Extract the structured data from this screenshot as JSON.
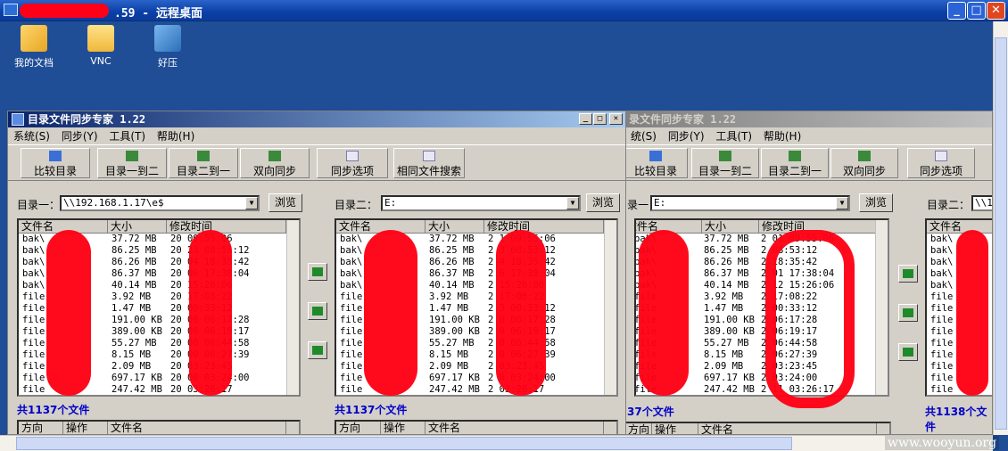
{
  "remote_title": ".59 - 远程桌面",
  "desktop_icons": [
    {
      "label": "我的文档"
    },
    {
      "label": "VNC"
    },
    {
      "label": "好压"
    }
  ],
  "app": {
    "title": "目录文件同步专家 1.22",
    "menu": [
      "系统(S)",
      "同步(Y)",
      "工具(T)",
      "帮助(H)"
    ],
    "toolbar": [
      "比较目录",
      "目录一到二",
      "目录二到一",
      "双向同步",
      "同步选项",
      "相同文件搜索"
    ],
    "browse_label": "浏览",
    "cols": [
      "文件名",
      "大小",
      "修改时间"
    ],
    "bottom_cols": [
      "方向",
      "操作",
      "文件名"
    ]
  },
  "window1": {
    "dir1_label": "目录一：",
    "dir1_value": "\\\\192.168.1.17\\e$",
    "dir2_label": "目录二：",
    "dir2_value": "E:",
    "count1": "共1137个文件",
    "count2": "共1137个文件",
    "left_rows": [
      {
        "name": "bak\\",
        "size": "37.72 MB",
        "time": "20   09:55:06"
      },
      {
        "name": "bak\\",
        "size": "86.25 MB",
        "time": "20  23 08:53:12"
      },
      {
        "name": "bak\\",
        "size": "86.26 MB",
        "time": "20  04 18:35:42"
      },
      {
        "name": "bak\\",
        "size": "86.37 MB",
        "time": "20  06 17:38:04"
      },
      {
        "name": "bak\\",
        "size": "40.14 MB",
        "time": "20    15:26:06"
      },
      {
        "name": "file",
        "size": "3.92 MB",
        "time": "20    17:08:22"
      },
      {
        "name": "file",
        "size": "1.47 MB",
        "time": "20    00:33:12"
      },
      {
        "name": "file",
        "size": "191.00 KB",
        "time": "20  00 06:17:28"
      },
      {
        "name": "file",
        "size": "389.00 KB",
        "time": "20  00 06:19:17"
      },
      {
        "name": "file",
        "size": "55.27 MB",
        "time": "20  00 06:44:58"
      },
      {
        "name": "file",
        "size": "8.15 MB",
        "time": "20  00 06:27:39"
      },
      {
        "name": "file",
        "size": "2.09 MB",
        "time": "20    03:23:45"
      },
      {
        "name": "file",
        "size": "697.17 KB",
        "time": "20  00 03:24:00"
      },
      {
        "name": "file",
        "size": "247.42 MB",
        "time": "20    03:26:17"
      }
    ],
    "right_rows": [
      {
        "name": "bak\\",
        "size": "37.72 MB",
        "time": "2   1 09:55:06"
      },
      {
        "name": "bak\\",
        "size": "86.25 MB",
        "time": "2   3 08:53:12"
      },
      {
        "name": "bak\\",
        "size": "86.26 MB",
        "time": "2   4 18:35:42"
      },
      {
        "name": "bak\\",
        "size": "86.37 MB",
        "time": "2   6 17:38:04"
      },
      {
        "name": "bak\\",
        "size": "40.14 MB",
        "time": "2     15:26:06"
      },
      {
        "name": "file",
        "size": "3.92 MB",
        "time": "2     17:08:22"
      },
      {
        "name": "file",
        "size": "1.47 MB",
        "time": "2   3 00:33:12"
      },
      {
        "name": "file",
        "size": "191.00 KB",
        "time": "2   0 06:17:28"
      },
      {
        "name": "file",
        "size": "389.00 KB",
        "time": "2   0 06:19:17"
      },
      {
        "name": "file",
        "size": "55.27 MB",
        "time": "2   0 06:44:58"
      },
      {
        "name": "file",
        "size": "8.15 MB",
        "time": "2   0 06:27:39"
      },
      {
        "name": "file",
        "size": "2.09 MB",
        "time": "2     03:23:45"
      },
      {
        "name": "file",
        "size": "697.17 KB",
        "time": "2   0 03:24:00"
      },
      {
        "name": "file",
        "size": "247.42 MB",
        "time": "2     03:26:17"
      }
    ]
  },
  "window2": {
    "title": "录文件同步专家 1.22",
    "menu": [
      "统(S)",
      "同步(Y)",
      "工具(T)",
      "帮助(H)"
    ],
    "toolbar": [
      "比较目录",
      "目录一到二",
      "目录二到一",
      "双向同步",
      "同步选项"
    ],
    "dir1_label": "录一：",
    "dir1_value": "E:",
    "dir2_label": "目录二：",
    "dir2_value": "\\\\1",
    "count1": "37个文件",
    "count2": "共1138个文件",
    "left_rows": [
      {
        "name": "bak\\",
        "size": "37.72 MB",
        "time": "2   01 09:55:06"
      },
      {
        "name": "bak\\",
        "size": "86.25 MB",
        "time": "2     08:53:12"
      },
      {
        "name": "bak\\",
        "size": "86.26 MB",
        "time": "2      18:35:42"
      },
      {
        "name": "bak\\",
        "size": "86.37 MB",
        "time": "2   01 17:38:04"
      },
      {
        "name": "bak\\",
        "size": "40.14 MB",
        "time": "2   12 15:26:06"
      },
      {
        "name": "file",
        "size": "3.92 MB",
        "time": "2       17:08:22"
      },
      {
        "name": "file",
        "size": "1.47 MB",
        "time": "2       00:33:12"
      },
      {
        "name": "file",
        "size": "191.00 KB",
        "time": "2     06:17:28"
      },
      {
        "name": "file",
        "size": "389.00 KB",
        "time": "2     06:19:17"
      },
      {
        "name": "file",
        "size": "55.27 MB",
        "time": "2     06:44:58"
      },
      {
        "name": "file",
        "size": "8.15 MB",
        "time": "2     06:27:39"
      },
      {
        "name": "file",
        "size": "2.09 MB",
        "time": "2     03:23:45"
      },
      {
        "name": "file",
        "size": "697.17 KB",
        "time": "2     03:24:00"
      },
      {
        "name": "file",
        "size": "247.42 MB",
        "time": "2   11 03:26:17"
      }
    ],
    "right_rows_names": [
      "bak\\",
      "bak\\",
      "bak\\",
      "bak\\",
      "bak\\",
      "file",
      "file",
      "file",
      "file",
      "file",
      "file",
      "file",
      "file",
      "file"
    ]
  },
  "watermark": "www.wooyun.org",
  "colors": {
    "redaction": "#ff0014",
    "desktop": "#1f4d96",
    "count_text": "#0000c8"
  }
}
